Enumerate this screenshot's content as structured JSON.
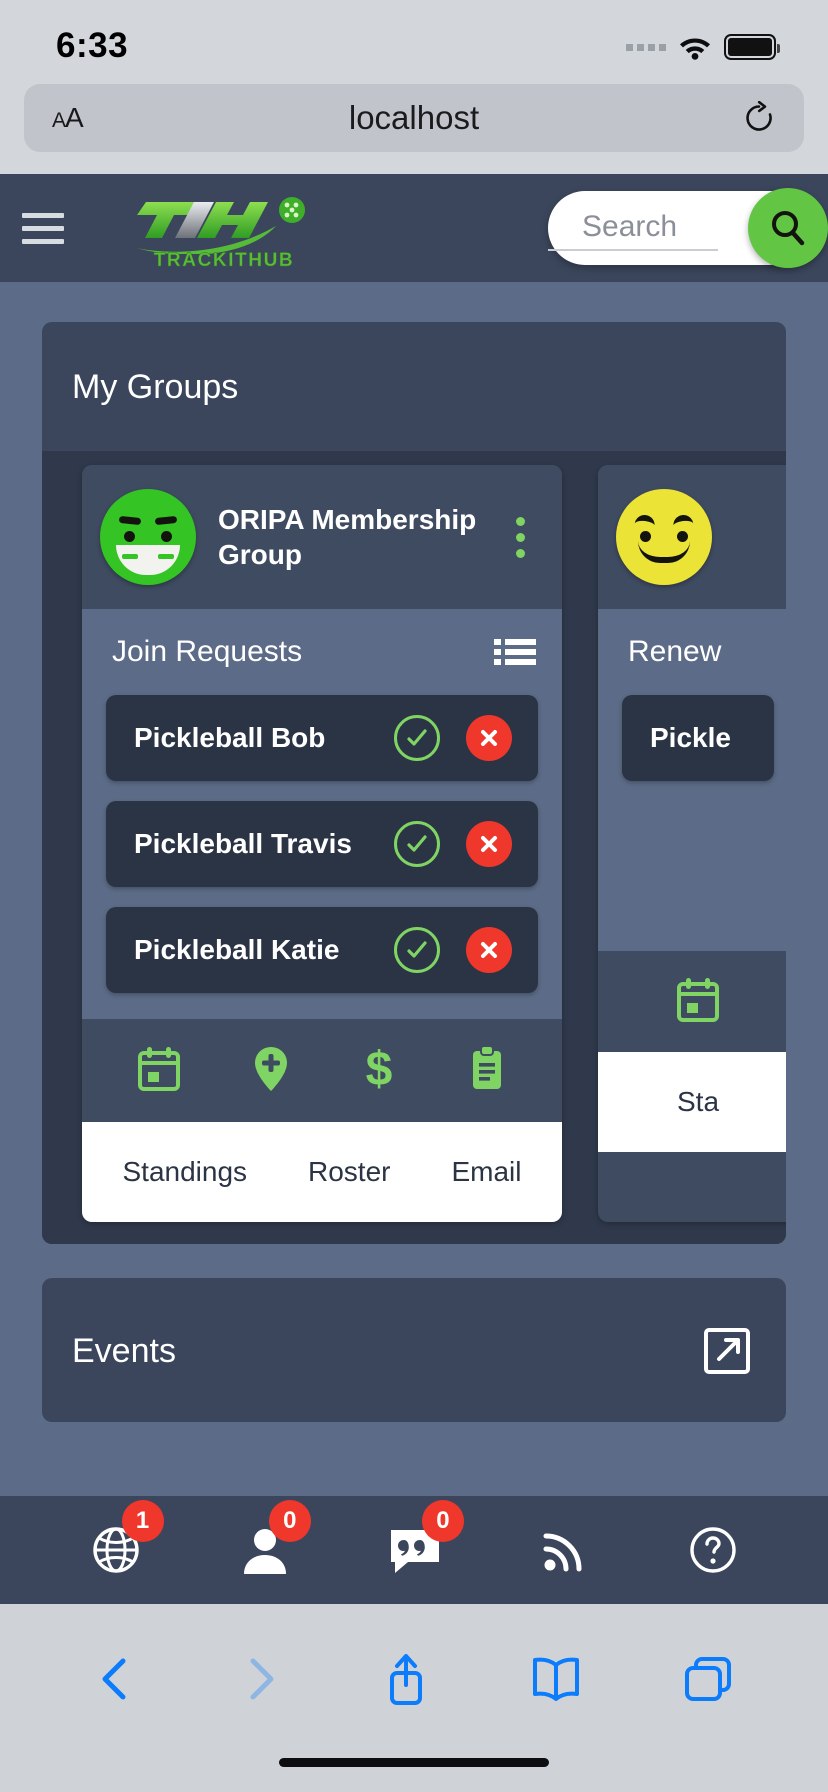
{
  "status_bar": {
    "time": "6:33",
    "signal_icon": "signal-dots-icon",
    "wifi_icon": "wifi-icon",
    "battery_icon": "battery-full-icon"
  },
  "browser": {
    "text_size_label": "AA",
    "text_size_icon": "text-size-icon",
    "url": "localhost",
    "reload_icon": "reload-icon",
    "toolbar": {
      "back_icon": "chevron-left-icon",
      "forward_icon": "chevron-right-icon",
      "share_icon": "share-icon",
      "bookmarks_icon": "book-icon",
      "tabs_icon": "tabs-icon"
    }
  },
  "app_header": {
    "menu_icon": "hamburger-menu-icon",
    "logo_mark": "TiH",
    "logo_wordmark": "TRACKITHUB",
    "logo_ball_icon": "pickleball-icon",
    "search": {
      "placeholder": "Search",
      "value": "",
      "button_icon": "search-icon"
    }
  },
  "my_groups": {
    "title": "My Groups",
    "cards": [
      {
        "avatar_icon": "smiley-green-avatar",
        "avatar_color": "#34c424",
        "name": "ORIPA Membership Group",
        "menu_icon": "kebab-menu-icon",
        "section": {
          "title": "Join Requests",
          "list_icon": "list-view-icon"
        },
        "requests": [
          {
            "name": "Pickleball Bob",
            "accept_icon": "check-circle-icon",
            "reject_icon": "x-circle-icon"
          },
          {
            "name": "Pickleball Travis",
            "accept_icon": "check-circle-icon",
            "reject_icon": "x-circle-icon"
          },
          {
            "name": "Pickleball Katie",
            "accept_icon": "check-circle-icon",
            "reject_icon": "x-circle-icon"
          }
        ],
        "quick_icons": [
          "calendar-icon",
          "location-pin-plus-icon",
          "dollar-icon",
          "clipboard-icon"
        ],
        "tabs": [
          "Standings",
          "Roster",
          "Email"
        ]
      },
      {
        "avatar_icon": "smiley-yellow-avatar",
        "avatar_color": "#ece337",
        "name": "",
        "section": {
          "title": "Renew",
          "list_icon": "list-view-icon"
        },
        "requests": [
          {
            "name": "Pickle",
            "accept_icon": "check-circle-icon",
            "reject_icon": "x-circle-icon"
          }
        ],
        "quick_icons": [
          "calendar-icon"
        ],
        "tabs": [
          "Sta"
        ]
      }
    ]
  },
  "events": {
    "title": "Events",
    "expand_icon": "open-external-icon"
  },
  "app_nav": [
    {
      "name": "globe-icon",
      "badge": "1"
    },
    {
      "name": "person-icon",
      "badge": "0"
    },
    {
      "name": "chat-quote-icon",
      "badge": "0"
    },
    {
      "name": "rss-icon",
      "badge": null
    },
    {
      "name": "help-circle-icon",
      "badge": null
    }
  ],
  "colors": {
    "header_bg": "#3b465c",
    "page_bg": "#5c6b87",
    "panel_bg": "#3b465c",
    "card_bg": "#3f4b61",
    "row_bg": "#2b3444",
    "accent_green": "#62c544",
    "accent_red": "#f0372c",
    "badge_red": "#f0372c"
  }
}
